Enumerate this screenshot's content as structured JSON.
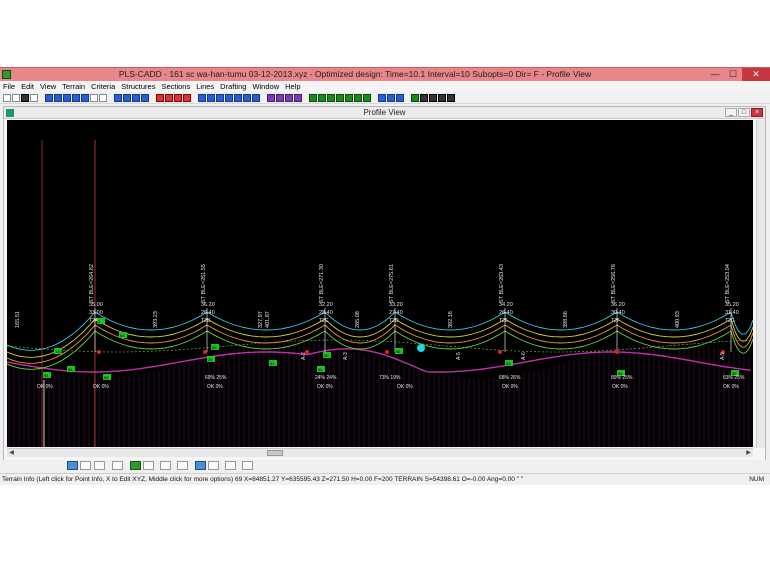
{
  "window": {
    "title": "PLS-CADD - 161 sc wa-han-tumu 03-12-2013.xyz - Optimized design: Time=10.1 Interval=10 Subopts=0 Dir= F - Profile View",
    "buttons": {
      "minimize": "—",
      "maximize": "☐",
      "close": "✕"
    }
  },
  "menu": [
    "File",
    "Edit",
    "View",
    "Terrain",
    "Criteria",
    "Structures",
    "Sections",
    "Lines",
    "Drafting",
    "Window",
    "Help"
  ],
  "profile_view": {
    "title": "Profile View",
    "structure_tags": [
      "133",
      "2",
      "53",
      "26",
      "51",
      "50",
      "55",
      "53",
      "56",
      "55",
      "56",
      "54",
      "56",
      "59",
      "60"
    ],
    "towers": [
      {
        "label": "T2A",
        "elev": "35.00",
        "left": "ST BLE=264.82",
        "right": "33.00"
      },
      {
        "label": "T2B",
        "elev": "36.20",
        "left": "ST BLE=261.55",
        "right": "26.40"
      },
      {
        "label": "T2C",
        "elev": "32.20",
        "left": "ST BLE=271.30",
        "right": "28.40"
      },
      {
        "label": "T2D",
        "elev": "33.20",
        "left": "ST BLE=275.61",
        "right": "27.40"
      },
      {
        "label": "T2E",
        "elev": "34.20",
        "left": "ST BLE=263.43",
        "right": "26.40"
      },
      {
        "label": "T2F",
        "elev": "36.20",
        "left": "ST BLE=256.76",
        "right": "30.40"
      },
      {
        "label": "T2G",
        "elev": "35.20",
        "left": "ST BLE=253.04",
        "right": "31.40"
      }
    ],
    "span_labels": [
      "165.51",
      "393.23",
      "327.97",
      "401.87",
      "285.08",
      "392.16",
      "398.66",
      "400.93"
    ],
    "ok_labels": [
      "OK 0%",
      "OK 0%",
      "OK 0%",
      "OK 0%",
      "OK 0%",
      "OK 0%",
      "OK 0%",
      "OK 0%"
    ],
    "usage_labels": [
      "69% 25%",
      "24% 24%",
      "73% 19%",
      "68% 26%",
      "89% 25%",
      "63% 25%"
    ],
    "point_labels": [
      "A-2",
      "A-3",
      "A-5",
      "A-6",
      "A-9"
    ]
  },
  "status": {
    "text": "Terrain Info (Left click for Point Info, X to Edit XYZ, Middle click for more options) 69 X=84851.27 Y=635595.43 Z=271.50 H=0.00 F=200 TERRAIN S=54398.61 O=-0.00 Ang=0.00 \" \"",
    "num": "NUM"
  },
  "colors": {
    "titlebar": "#e9868a",
    "plot_bg": "#000000",
    "conductor_cyan": "#3ec6e0",
    "conductor_yellow": "#d8d23a",
    "conductor_green": "#6bd142",
    "conductor_orange": "#e89a3a",
    "ground_magenta": "#c02fa8",
    "ground_line": "#9a2aa0",
    "tag_green": "#1fc21f",
    "text_white": "#e6e6e6"
  }
}
